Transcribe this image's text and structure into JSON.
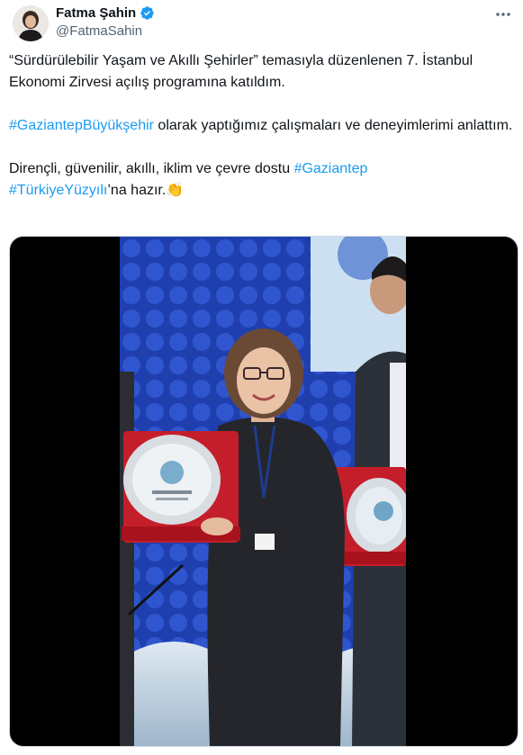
{
  "author": {
    "display_name": "Fatma Şahin",
    "handle": "@FatmaSahin",
    "verified": true
  },
  "icons": {
    "verified": "verified-badge-icon",
    "more": "more-options-icon"
  },
  "tweet": {
    "p1": "“Sürdürülebilir Yaşam ve Akıllı Şehirler” temasıyla düzenlenen 7. İstanbul Ekonomi Zirvesi açılış programına katıldım.",
    "p2_tag": "#GaziantepBüyükşehir",
    "p2_rest": " olarak yaptığımız çalışmaları ve deneyimlerimi anlattım.",
    "p3_start": "Dirençli, güvenilir, akıllı, iklim ve çevre dostu ",
    "p3_tag1": "#Gaziantep",
    "p3_tag2": "#TürkiyeYüzyılı",
    "p3_end": "’na hazır.",
    "emoji": "👏"
  },
  "colors": {
    "link": "#1d9bf0",
    "verified": "#1d9bf0",
    "text": "#0f1419",
    "secondary": "#536471"
  }
}
